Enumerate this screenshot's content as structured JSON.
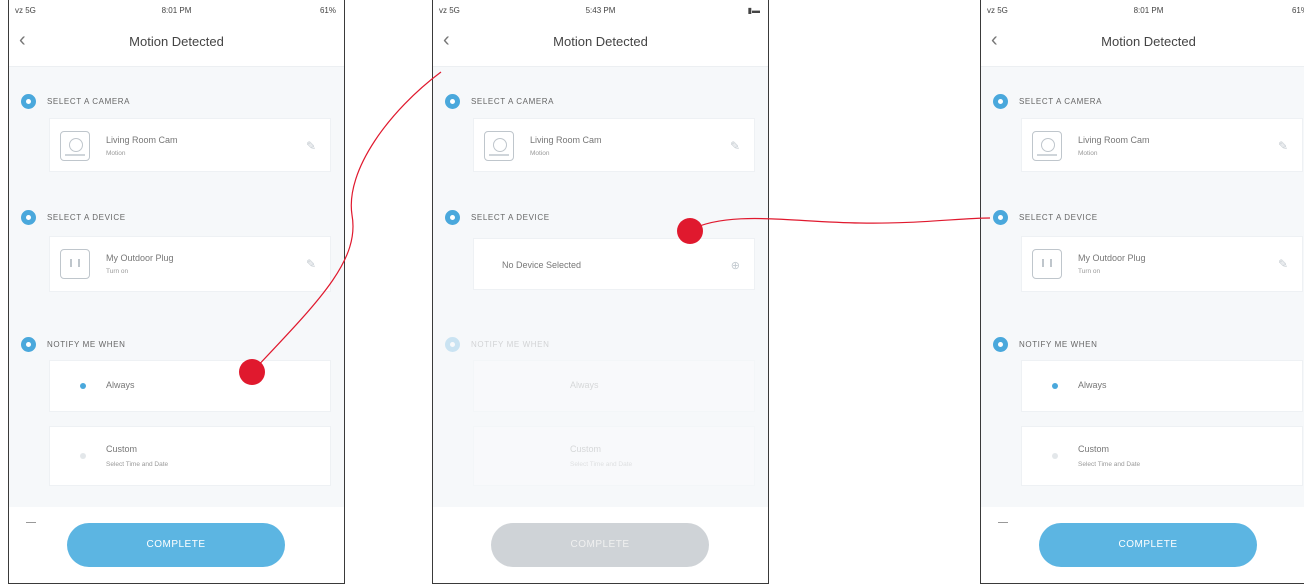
{
  "status": {
    "carrier": "vz 5G",
    "right": "61%"
  },
  "phone_a": {
    "time": "8:01 PM",
    "title": "Motion Detected",
    "section1_label": "SELECT A CAMERA",
    "camera_name": "Living Room Cam",
    "camera_sub": "Motion",
    "section2_label": "SELECT A DEVICE",
    "device_name": "My Outdoor Plug",
    "device_sub": "Turn on",
    "section3_label": "NOTIFY ME WHEN",
    "opt_always": "Always",
    "opt_custom": "Custom",
    "opt_custom_sub": "Select Time and Date",
    "complete": "COMPLETE"
  },
  "phone_b": {
    "time": "5:43 PM",
    "title": "Motion Detected",
    "section1_label": "SELECT A CAMERA",
    "camera_name": "Living Room Cam",
    "camera_sub": "Motion",
    "section2_label": "SELECT A DEVICE",
    "no_device": "No Device Selected",
    "section3_label": "NOTIFY ME WHEN",
    "opt_always": "Always",
    "opt_custom": "Custom",
    "opt_custom_sub": "Select Time and Date",
    "complete": "COMPLETE"
  },
  "phone_c": {
    "time": "8:01 PM",
    "title": "Motion Detected",
    "section1_label": "SELECT A CAMERA",
    "camera_name": "Living Room Cam",
    "camera_sub": "Motion",
    "section2_label": "SELECT A DEVICE",
    "device_name": "My Outdoor Plug",
    "device_sub": "Turn on",
    "section3_label": "NOTIFY ME WHEN",
    "opt_always": "Always",
    "opt_custom": "Custom",
    "opt_custom_sub": "Select Time and Date",
    "complete": "COMPLETE"
  },
  "colors": {
    "accent": "#4aa8dc",
    "annotation": "#e0192e",
    "disabled": "#cfd3d7"
  }
}
